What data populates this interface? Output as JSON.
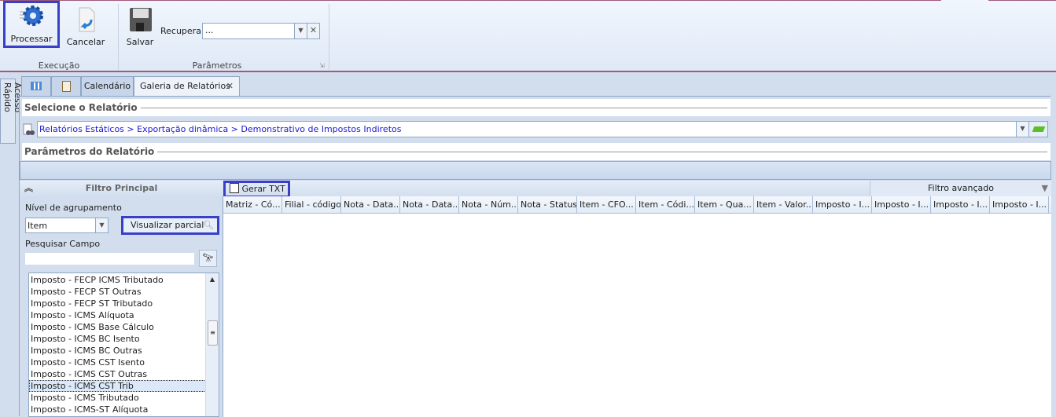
{
  "ribbon": {
    "execucao": {
      "label": "Execução",
      "processar": "Processar",
      "cancelar": "Cancelar"
    },
    "parametros": {
      "label": "Parâmetros",
      "salvar": "Salvar",
      "recuperar_label": "Recuperar",
      "recuperar_value": "..."
    }
  },
  "side_tab": "Acesso Rápido",
  "tabs": [
    {
      "label": "Calendário"
    },
    {
      "label": "Galeria de Relatórios",
      "active": true
    }
  ],
  "selecione": {
    "title": "Selecione o Relatório",
    "path": "Relatórios Estáticos > Exportação dinâmica > Demonstrativo de Impostos Indiretos"
  },
  "parametros_title": "Parâmetros do Relatório",
  "filtro": {
    "title": "Filtro Principal",
    "nivel_label": "Nível de agrupamento",
    "nivel_value": "Item",
    "visualizar": "Visualizar parcial",
    "pesquisar_label": "Pesquisar Campo",
    "pesquisar_value": "",
    "fields": [
      "Imposto - FECP ICMS Tributado",
      "Imposto - FECP ST Outras",
      "Imposto - FECP ST Tributado",
      "Imposto - ICMS Alíquota",
      "Imposto - ICMS Base Cálculo",
      "Imposto - ICMS BC Isento",
      "Imposto - ICMS BC Outras",
      "Imposto - ICMS CST Isento",
      "Imposto - ICMS CST Outras",
      "Imposto - ICMS CST Trib",
      "Imposto - ICMS Tributado",
      "Imposto - ICMS-ST Alíquota"
    ],
    "selected_field": "Imposto - ICMS CST Trib"
  },
  "grid": {
    "gerar_txt": "Gerar TXT",
    "gerar_txt_checked": false,
    "filtro_avancado": "Filtro avançado",
    "columns": [
      "Matriz - Có...",
      "Filial - código",
      "Nota - Data...",
      "Nota - Data...",
      "Nota - Núm...",
      "Nota - Status",
      "Item - CFO...",
      "Item - Códi...",
      "Item - Qua...",
      "Item - Valor...",
      "Imposto - I...",
      "Imposto - I...",
      "Imposto - I...",
      "Imposto - I..."
    ]
  }
}
